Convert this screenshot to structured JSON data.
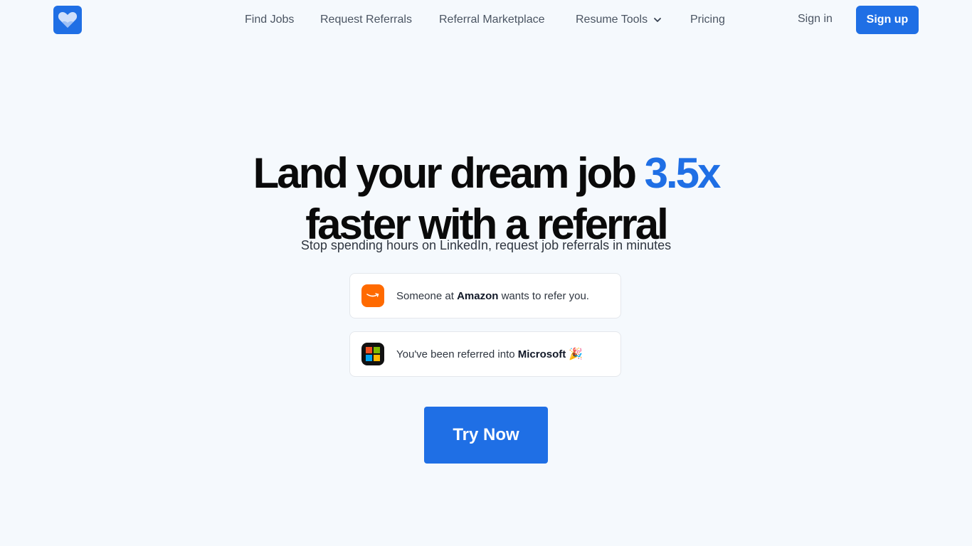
{
  "nav": {
    "links": [
      "Find Jobs",
      "Request Referrals",
      "Referral Marketplace",
      "Resume Tools",
      "Pricing"
    ],
    "sign_in": "Sign in",
    "sign_up": "Sign up"
  },
  "hero": {
    "headline_part1": "Land your dream job ",
    "headline_accent": "3.5x",
    "headline_part2": "faster with a referral",
    "subhead": "Stop spending hours on LinkedIn, request job referrals in minutes"
  },
  "notifications": [
    {
      "prefix": "Someone at ",
      "company": "Amazon",
      "suffix": " wants to refer you."
    },
    {
      "prefix": "You've been referred into ",
      "company": "Microsoft",
      "suffix": "",
      "emoji": "🎉"
    }
  ],
  "cta": {
    "label": "Try Now"
  },
  "colors": {
    "accent": "#1f6fe5",
    "amazon": "#ff6a00",
    "background": "#f5f9fd"
  },
  "icons": [
    "heart-logo-icon",
    "chevron-down-icon",
    "amazon-icon",
    "microsoft-icon"
  ]
}
